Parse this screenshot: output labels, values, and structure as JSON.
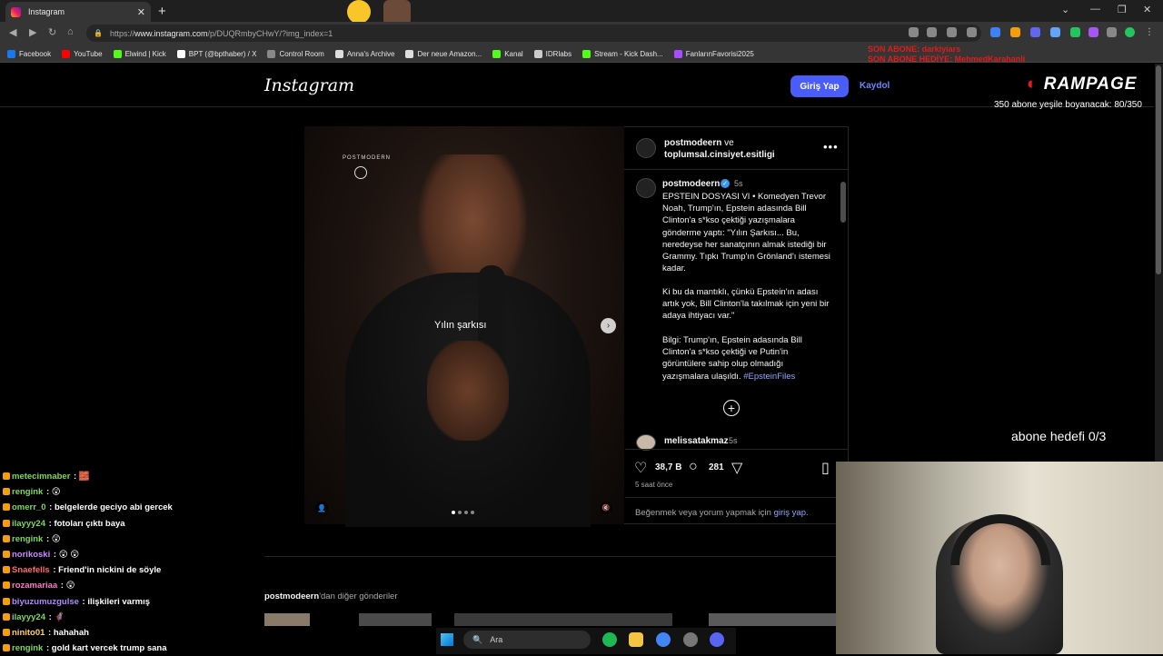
{
  "browser": {
    "tab_title": "Instagram",
    "tab_close": "✕",
    "new_tab": "+",
    "url_prefix": "https://",
    "url_host": "www.instagram.com",
    "url_path": "/p/DUQRmbyCHwY/?img_index=1",
    "bookmarks": [
      {
        "label": "Facebook",
        "color": "#1877f2"
      },
      {
        "label": "YouTube",
        "color": "#ff0000"
      },
      {
        "label": "Elwind | Kick",
        "color": "#53fc18"
      },
      {
        "label": "BPT (@bpthaber) / X",
        "color": "#ffffff"
      },
      {
        "label": "Control Room",
        "color": "#888888"
      },
      {
        "label": "Anna's Archive",
        "color": "#dddddd"
      },
      {
        "label": "Der neue Amazon...",
        "color": "#dddddd"
      },
      {
        "label": "Kanal",
        "color": "#53fc18"
      },
      {
        "label": "IDRlabs",
        "color": "#cccccc"
      },
      {
        "label": "Stream - Kick Dash...",
        "color": "#53fc18"
      },
      {
        "label": "FanlarınFavorisi2025",
        "color": "#a64dff"
      }
    ]
  },
  "instagram": {
    "logo": "Instagram",
    "login_button": "Giriş Yap",
    "signup_link": "Kaydol",
    "post": {
      "media_watermark": "POSTMODERN",
      "media_caption": "Yılın şarkısı",
      "header_user": "postmodeern",
      "header_and": "ve",
      "header_collab": "toplumsal.cinsiyet.esitligi",
      "caption_user": "postmodeern",
      "caption_time": "5s",
      "caption_p1": "EPSTEIN DOSYASI VI • Komedyen Trevor Noah, Trump'ın, Epstein adasında Bill Clinton'a s*kso çektiği yazışmalara gönderme yaptı: \"Yılın Şarkısı... Bu, neredeyse her sanatçının almak istediği bir Grammy. Tıpkı Trump'ın Grönland'ı istemesi kadar.",
      "caption_p2": "Ki bu da mantıklı, çünkü Epstein'ın adası artık yok, Bill Clinton'la takılmak için yeni bir adaya ihtiyacı var.\"",
      "caption_p3": "Bilgi: Trump'ın, Epstein adasında Bill Clinton'a s*kso çektiği ve Putin'in görüntülere sahip olup olmadığı yazışmalara ulaşıldı.",
      "caption_hashtag": "#EpsteinFiles",
      "comment_user": "melissatakmaz",
      "comment_time": "5s",
      "likes": "38,7 B",
      "comments": "281",
      "posted_ago": "5 saat önce",
      "login_prompt_pre": "Beğenmek veya yorum yapmak için",
      "login_prompt_link": "giriş yap",
      "login_prompt_post": "."
    },
    "more_posts_user": "postmodeern",
    "more_posts_suffix": "'dan diğer gönderiler"
  },
  "stream_overlay": {
    "son_abone": "SON ABONE: darkiyiars",
    "son_abone_hediye": "SON ABONE HEDİYE: MehmedKarahanli",
    "brand": "RAMPAGE",
    "sub_progress_text": "350 abone yeşile boyanacak: 80/350",
    "abone_hedefi": "abone hedefi 0/3"
  },
  "chat": [
    {
      "user": "metecimnaber",
      "msg": "🧱",
      "color": "#7ed957"
    },
    {
      "user": "rengink",
      "msg": "😲",
      "color": "#7ed957"
    },
    {
      "user": "omerr_0",
      "msg": "belgelerde geciyo abi gercek",
      "color": "#7ed957"
    },
    {
      "user": "ilayyy24",
      "msg": "fotoları çıktı baya",
      "color": "#7ed957"
    },
    {
      "user": "rengink",
      "msg": "😲",
      "color": "#7ed957"
    },
    {
      "user": "norikoski",
      "msg": "😲 😲",
      "color": "#c98cff"
    },
    {
      "user": "Snaefells",
      "msg": "Friend'in nickini de söyle",
      "color": "#ff6b6b"
    },
    {
      "user": "rozamariaa",
      "msg": "😲",
      "color": "#ff79c6"
    },
    {
      "user": "biyuzumuzgulse",
      "msg": "ilişkileri varmış",
      "color": "#b388ff"
    },
    {
      "user": "ilayyy24",
      "msg": "🦸",
      "color": "#7ed957"
    },
    {
      "user": "ninito01",
      "msg": "hahahah",
      "color": "#ffd166"
    },
    {
      "user": "rengink",
      "msg": "gold kart vercek trump sana",
      "color": "#7ed957"
    }
  ],
  "taskbar": {
    "search_placeholder": "Ara"
  }
}
